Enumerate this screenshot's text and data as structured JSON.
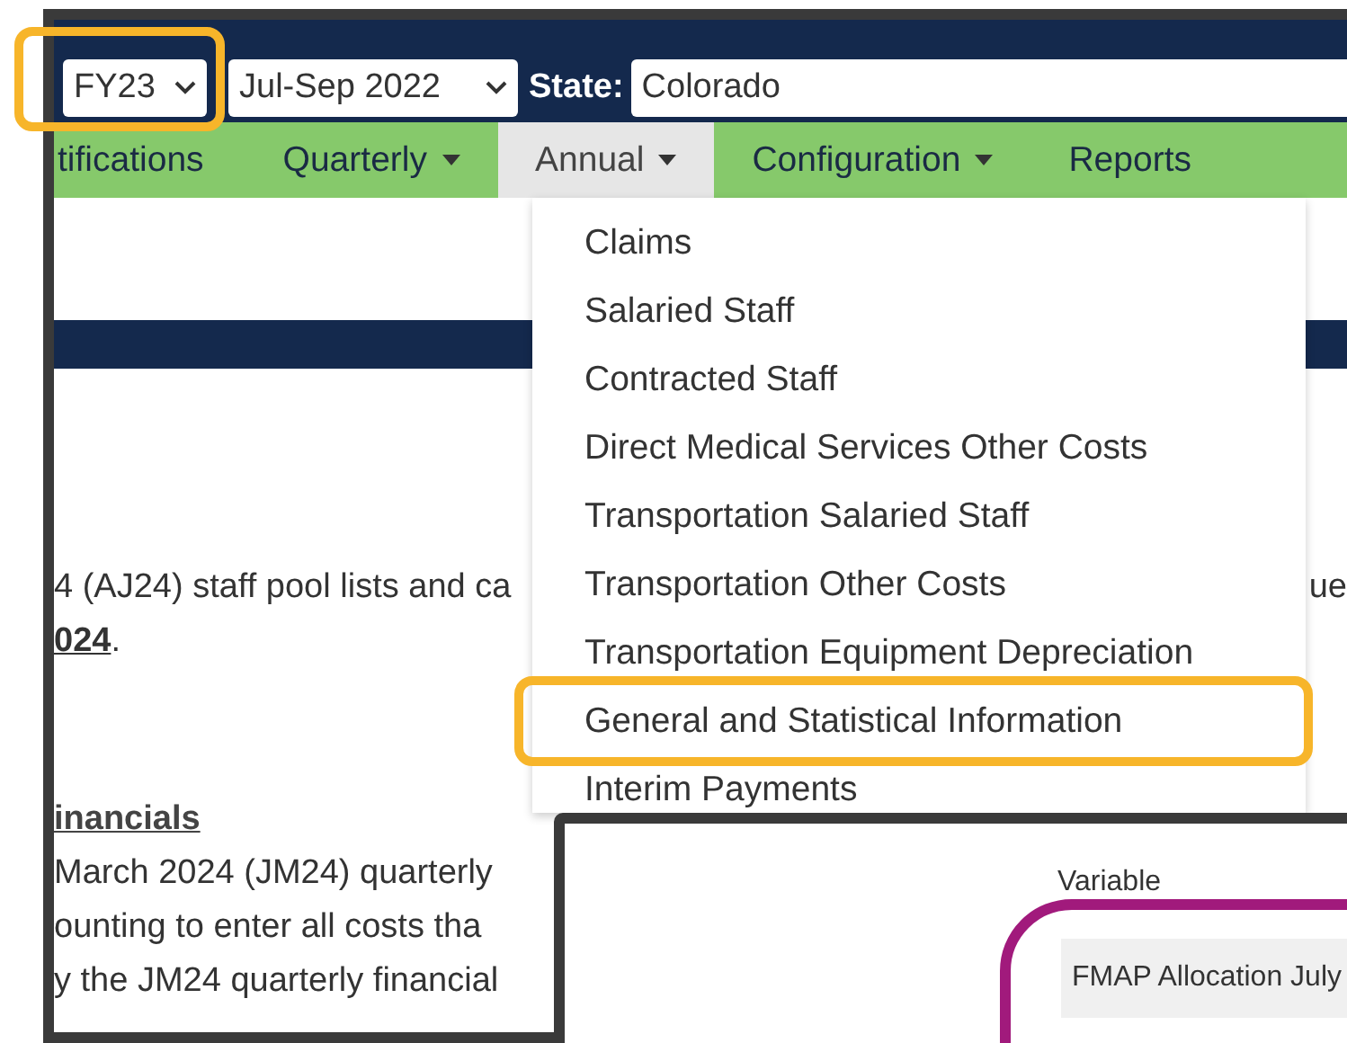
{
  "top_bar": {
    "fiscal_year": {
      "value": "FY23",
      "highlighted": true
    },
    "quarter": "Jul-Sep 2022",
    "state_label": "State:",
    "state": "Colorado"
  },
  "nav": [
    {
      "label": "tifications",
      "dropdown": false,
      "selected": false
    },
    {
      "label": "Quarterly",
      "dropdown": true,
      "selected": false
    },
    {
      "label": "Annual",
      "dropdown": true,
      "selected": true
    },
    {
      "label": "Configuration",
      "dropdown": true,
      "selected": false
    },
    {
      "label": "Reports",
      "dropdown": false,
      "selected": false
    }
  ],
  "annual_menu": [
    {
      "label": "Claims",
      "highlighted": false
    },
    {
      "label": "Salaried Staff",
      "highlighted": false
    },
    {
      "label": "Contracted Staff",
      "highlighted": false
    },
    {
      "label": "Direct Medical Services Other Costs",
      "highlighted": false
    },
    {
      "label": "Transportation Salaried Staff",
      "highlighted": false
    },
    {
      "label": "Transportation Other Costs",
      "highlighted": false
    },
    {
      "label": "Transportation Equipment Depreciation",
      "highlighted": false
    },
    {
      "label": "General and Statistical Information",
      "highlighted": true
    },
    {
      "label": "Interim Payments",
      "highlighted": false
    }
  ],
  "content": {
    "line_1": "4 (AJ24) staff pool lists and ca",
    "line_1_end": "ue",
    "link": "024",
    "link_suffix": ".",
    "heading": "inancials",
    "paragraph": [
      "March 2024 (JM24) quarterly",
      "ounting to enter all costs tha",
      "y the JM24 quarterly financial"
    ]
  },
  "inset": {
    "column_header": "Variable",
    "cell": "FMAP Allocation July",
    "highlighted": true
  }
}
